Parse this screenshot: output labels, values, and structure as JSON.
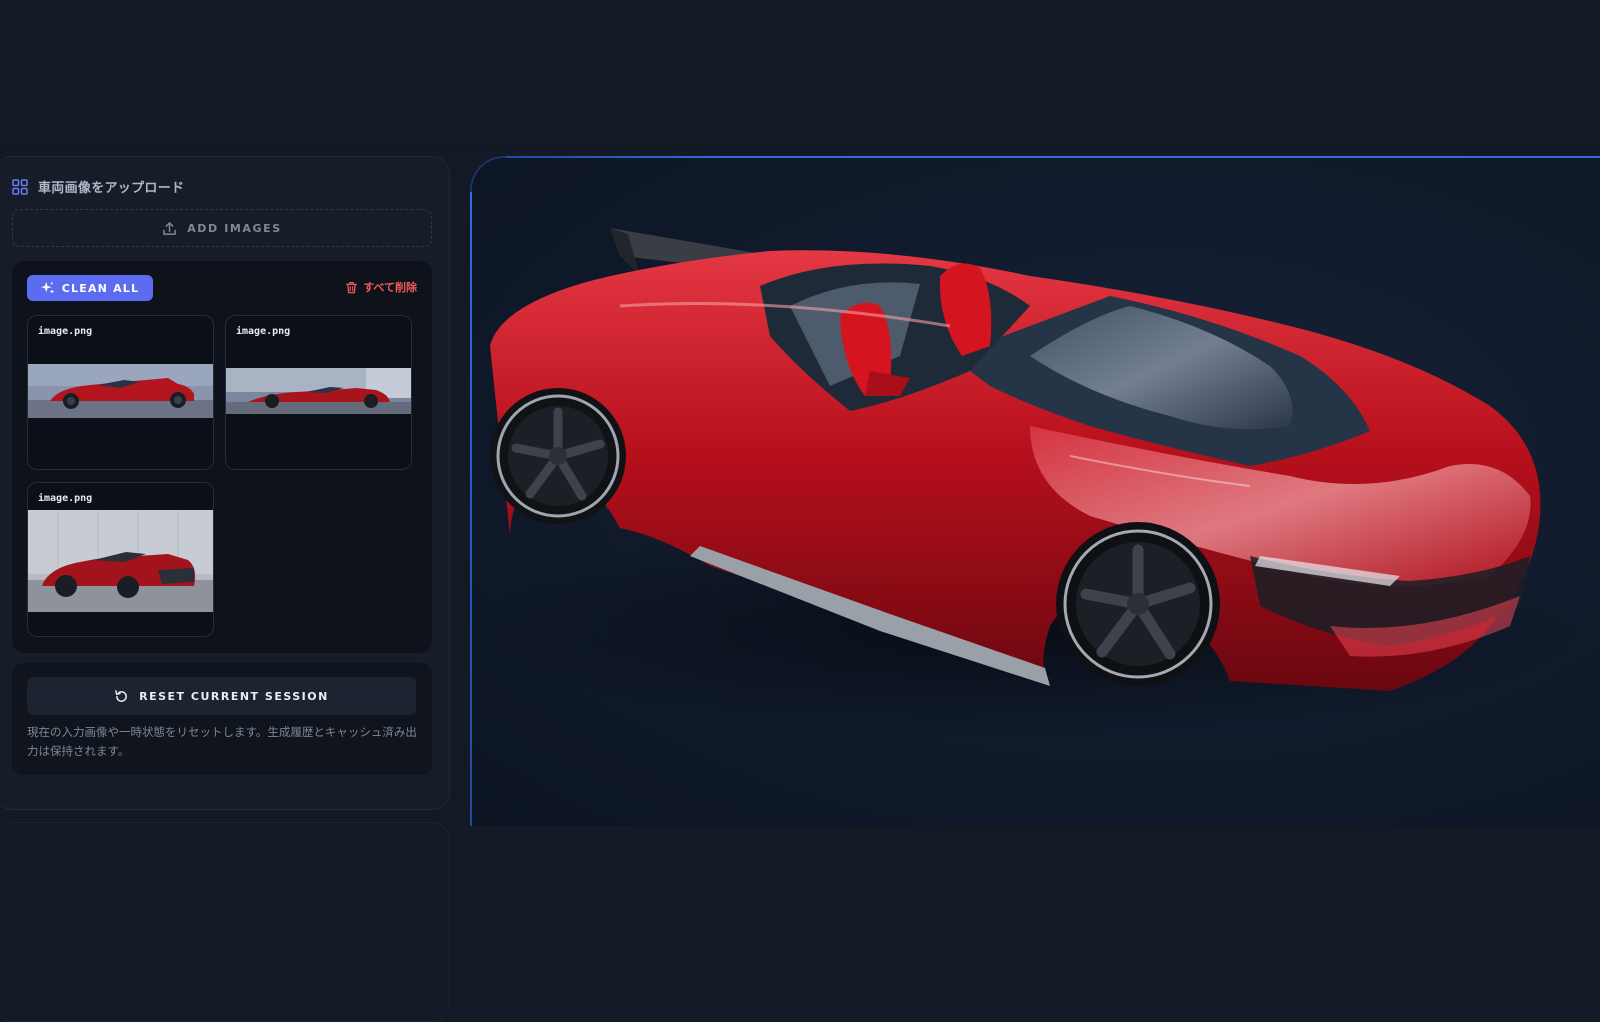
{
  "upload": {
    "title": "車両画像をアップロード",
    "add_images_label": "ADD IMAGES"
  },
  "toolbar": {
    "clean_all_label": "CLEAN ALL",
    "delete_all_label": "すべて削除"
  },
  "images": [
    {
      "name": "image.png"
    },
    {
      "name": "image.png"
    },
    {
      "name": "image.png"
    }
  ],
  "session": {
    "reset_label": "RESET CURRENT SESSION",
    "reset_description": "現在の入力画像や一時状態をリセットします。生成履歴とキャッシュ済み出力は保持されます。"
  },
  "colors": {
    "accent": "#5b6cf0",
    "danger": "#f05a5a",
    "viewer_border": "#2e6de0",
    "car_body": "#c0141f"
  },
  "icons": {
    "upload_header": "grid-icon",
    "add_images": "upload-icon",
    "clean_all": "sparkle-icon",
    "delete_all": "trash-icon",
    "reset": "reset-icon"
  }
}
